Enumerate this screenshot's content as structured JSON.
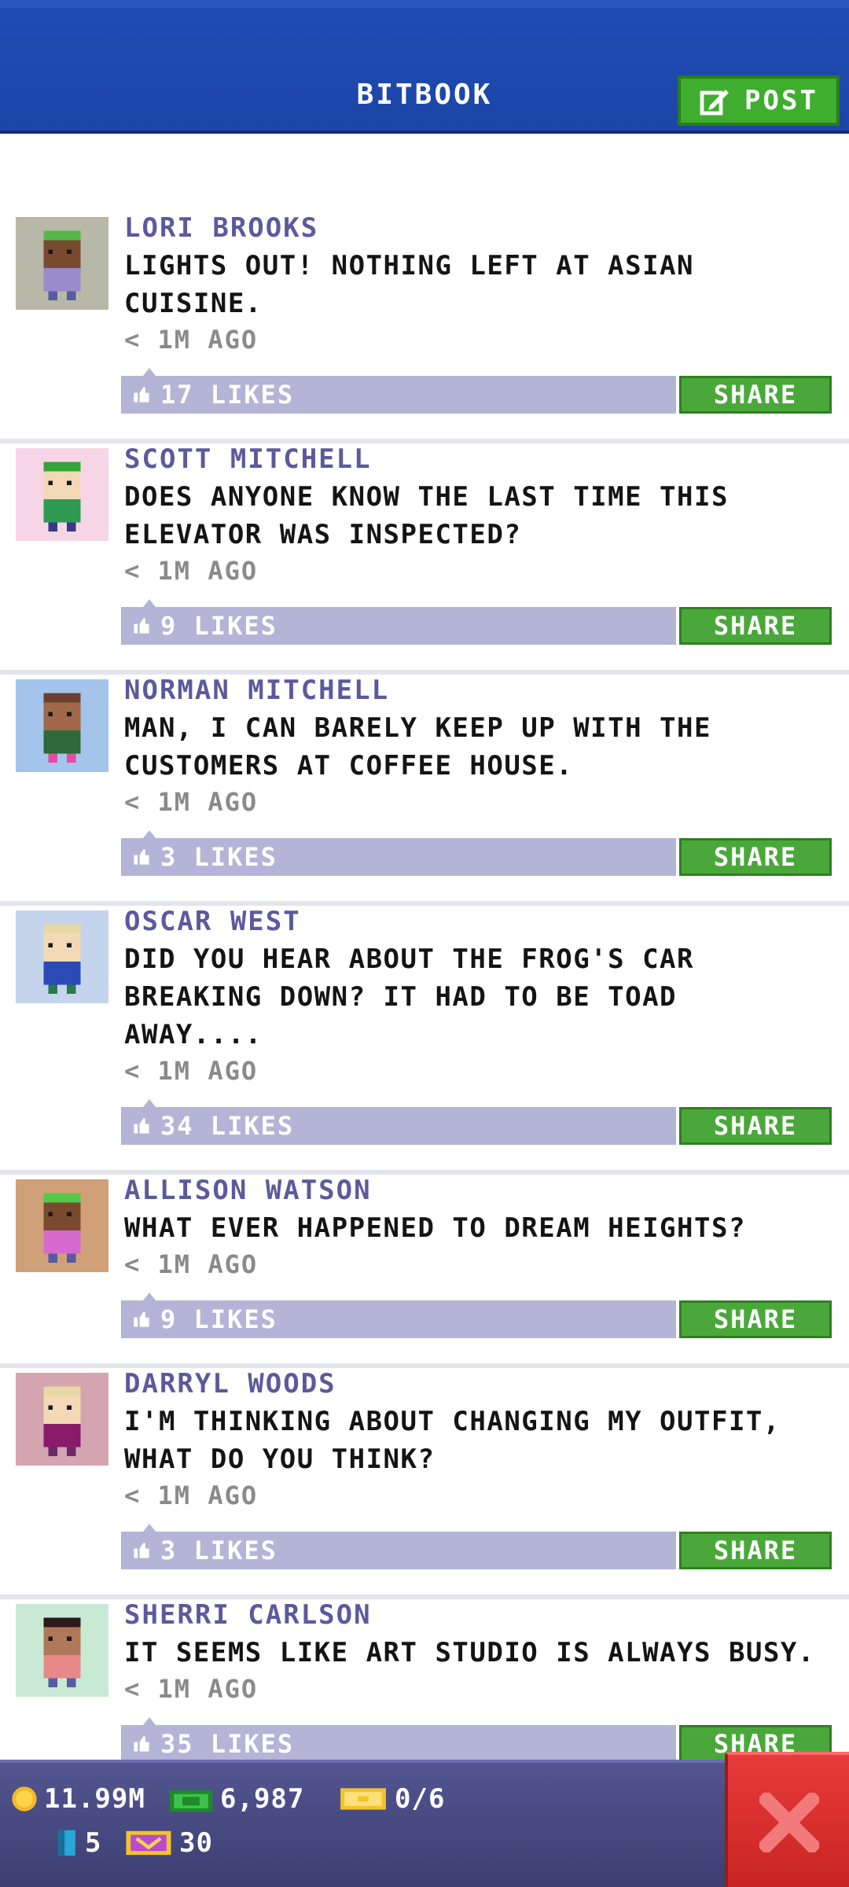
{
  "header": {
    "title": "BITBOOK",
    "post_label": "POST"
  },
  "posts": [
    {
      "author": "LORI BROOKS",
      "text": "LIGHTS OUT! NOTHING LEFT AT ASIAN CUISINE.",
      "time": "< 1M AGO",
      "likes": "17 LIKES",
      "share": "SHARE"
    },
    {
      "author": "SCOTT MITCHELL",
      "text": "DOES ANYONE KNOW THE LAST TIME THIS ELEVATOR WAS INSPECTED?",
      "time": "< 1M AGO",
      "likes": "9 LIKES",
      "share": "SHARE"
    },
    {
      "author": "NORMAN MITCHELL",
      "text": "MAN, I CAN BARELY KEEP UP WITH THE CUSTOMERS AT COFFEE HOUSE.",
      "time": "< 1M AGO",
      "likes": "3 LIKES",
      "share": "SHARE"
    },
    {
      "author": "OSCAR WEST",
      "text": "DID YOU HEAR ABOUT THE FROG'S CAR BREAKING DOWN? IT HAD TO BE TOAD AWAY....",
      "time": "< 1M AGO",
      "likes": "34 LIKES",
      "share": "SHARE"
    },
    {
      "author": "ALLISON WATSON",
      "text": "WHAT EVER HAPPENED TO DREAM HEIGHTS?",
      "time": "< 1M AGO",
      "likes": "9 LIKES",
      "share": "SHARE"
    },
    {
      "author": "DARRYL WOODS",
      "text": "I'M THINKING ABOUT CHANGING MY OUTFIT, WHAT DO YOU THINK?",
      "time": "< 1M AGO",
      "likes": "3 LIKES",
      "share": "SHARE"
    },
    {
      "author": "SHERRI CARLSON",
      "text": "IT SEEMS LIKE ART STUDIO IS ALWAYS BUSY.",
      "time": "< 1M AGO",
      "likes": "35 LIKES",
      "share": "SHARE"
    }
  ],
  "avatars": [
    {
      "bg": "#b8b8a8",
      "skin": "#7a4a30",
      "hair": "#56b84a",
      "shirt": "#9a8ccc",
      "pants": "#5a5aa0"
    },
    {
      "bg": "#f6d6e6",
      "skin": "#f2d8b4",
      "hair": "#36a43a",
      "shirt": "#2e9a52",
      "pants": "#3a3a8a"
    },
    {
      "bg": "#a4c4ec",
      "skin": "#a06848",
      "hair": "#6a4030",
      "shirt": "#2e6a3a",
      "pants": "#e84aa0"
    },
    {
      "bg": "#c4d4ec",
      "skin": "#f2d8b4",
      "hair": "#e8d8a4",
      "shirt": "#2a4ab8",
      "pants": "#2a7a4a"
    },
    {
      "bg": "#d0a078",
      "skin": "#7a4a30",
      "hair": "#56c84a",
      "shirt": "#d46ad0",
      "pants": "#5a5aa0"
    },
    {
      "bg": "#d4a4b0",
      "skin": "#f2d8b4",
      "hair": "#e8d8a4",
      "shirt": "#8a1a6a",
      "pants": "#6a2a6a"
    },
    {
      "bg": "#c8ead4",
      "skin": "#b07858",
      "hair": "#2a1a18",
      "shirt": "#e88888",
      "pants": "#5a5aa0"
    }
  ],
  "status_bar": {
    "coins": "11.99M",
    "bux": "6,987",
    "tickets": "0/6",
    "keys": "5",
    "vip": "30"
  },
  "colors": {
    "header_blue": "#1f4cb4",
    "share_green": "#4aa83a",
    "likes_bar": "#b3b4d6",
    "author_text": "#5c5a9c",
    "close_red": "#d42c2c"
  }
}
